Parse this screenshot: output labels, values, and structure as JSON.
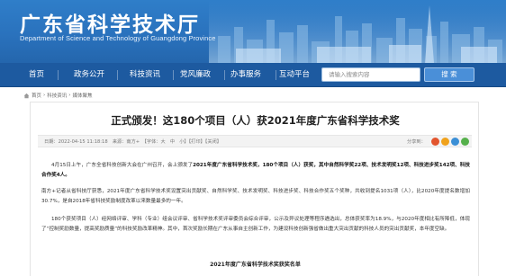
{
  "header": {
    "title": "广东省科学技术厅",
    "subtitle": "Department of Science and Technology of Guangdong Province"
  },
  "nav": {
    "items": [
      "首页",
      "政务公开",
      "科技资讯",
      "党风廉政",
      "办事服务",
      "互动平台"
    ],
    "search_placeholder": "请输入搜索内容",
    "search_button": "搜 索"
  },
  "breadcrumb": {
    "items": [
      "首页",
      "科技资讯",
      "媒体聚焦"
    ],
    "separator": "›"
  },
  "article": {
    "title": "正式颁发！这180个项目（人）获2021年度广东省科学技术奖",
    "meta": "日期：2022-04-15 11:18:18　来源：南方+　【字体：大　中　小】【打印】【关闭】",
    "share_label": "分享到：",
    "share_colors": [
      "#e2552e",
      "#f0a21c",
      "#3b8fd6",
      "#55b04b"
    ],
    "paragraphs": [
      {
        "before": "4月15日上午，广东全省科技创新大会在广州召开，会上颁发了",
        "bold": "2021年度广东省科学技术奖，180个项目（人）获奖，其中自然科学奖22项、技术发明奖12项、科技进步奖142项、科技合作奖4人。",
        "after": ""
      },
      {
        "before": "南方+记者从省科技厅获悉，2021年度广东省科学技术奖设置突出贡献奖、自然科学奖、技术发明奖、科技进步奖、科技合作奖五个奖种，共收到提名1031项（人），比2020年度提名数增加30.7%，是自2018年省科技奖励制度改革以来数量最多的一年。",
        "bold": "",
        "after": ""
      },
      {
        "before": "180个获奖项目（人）经网络评审、学科（专业）组会议评审、省科学技术奖评审委员会综合评审，公示及异议处理等程序遴选出，总体获奖率为18.9%，与2020年度相比有所降低，体现了“控制奖励数量，提高奖励质量”的科技奖励改革精神。其中，首次奖励长期在广东从事自主创新工作，为建设科技创新强省做出重大突出贡献的科技人员的突出贡献奖，本年度空缺。",
        "bold": "",
        "after": ""
      }
    ],
    "table_caption": "2021年度广东省科学技术奖获奖名单"
  },
  "colors": {
    "banner": "#2a72bd",
    "nav": "#1d5aa0",
    "search_button": "#4a8fd8",
    "meta_bar": "#f3f3f3"
  }
}
